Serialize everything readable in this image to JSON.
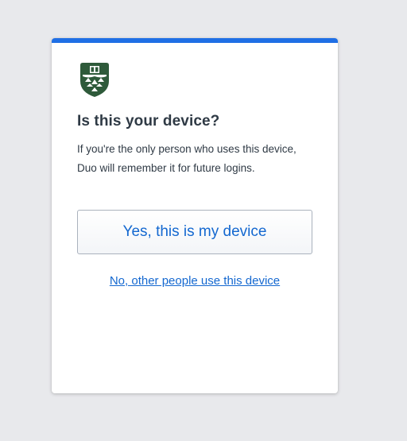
{
  "prompt": {
    "title": "Is this your device?",
    "description": "If you're the only person who uses this device, Duo will remember it for future logins.",
    "yes_label": "Yes, this is my device",
    "no_label": "No, other people use this device"
  },
  "logo": {
    "icon": "university-shield-logo-icon",
    "color": "#2e5a3a"
  },
  "colors": {
    "accent_bar": "#1f6fe5",
    "link": "#1468d0",
    "text": "#2f3a45",
    "background": "#e8e9ec"
  }
}
